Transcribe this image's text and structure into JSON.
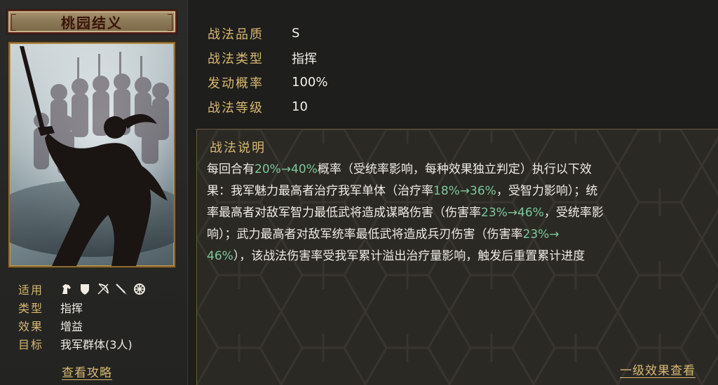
{
  "skill": {
    "name": "桃园结义"
  },
  "stats": [
    {
      "label": "战法品质",
      "value": "S"
    },
    {
      "label": "战法类型",
      "value": "指挥"
    },
    {
      "label": "发动概率",
      "value": "100%"
    },
    {
      "label": "战法等级",
      "value": "10"
    }
  ],
  "left_attrs": {
    "applicable_label": "适用",
    "applicable_icons": [
      "cavalry-icon",
      "shield-icon",
      "bow-icon",
      "spear-icon",
      "wheel-icon"
    ],
    "type_label": "类型",
    "type_value": "指挥",
    "effect_label": "效果",
    "effect_value": "增益",
    "target_label": "目标",
    "target_value": "我军群体(3人)"
  },
  "guide_link": "查看攻略",
  "description": {
    "title": "战法说明",
    "lines": [
      [
        {
          "t": "每回合有"
        },
        {
          "t": "20%→40%",
          "hl": true
        },
        {
          "t": "概率（受统率影响，每种效果独立判定）执行以下效"
        }
      ],
      [
        {
          "t": "果：我军魅力最高者治疗我军单体（治疗率"
        },
        {
          "t": "18%→36%",
          "hl": true
        },
        {
          "t": "，受智力影响）；统"
        }
      ],
      [
        {
          "t": "率最高者对敌军智力最低武将造成谋略伤害（伤害率"
        },
        {
          "t": "23%→46%",
          "hl": true
        },
        {
          "t": "，受统率影"
        }
      ],
      [
        {
          "t": "响）；武力最高者对敌军统率最低武将造成兵刃伤害（伤害率"
        },
        {
          "t": "23%→",
          "hl": true
        }
      ],
      [
        {
          "t": "46%",
          "hl": true
        },
        {
          "t": "），该战法伤害率受我军累计溢出治疗量影响，触发后重置累计进度"
        }
      ]
    ]
  },
  "effect_link": "一级效果查看",
  "colors": {
    "gold_label": "#d8b872",
    "highlight_green": "#7ec89a",
    "title_red": "#3a1408"
  }
}
